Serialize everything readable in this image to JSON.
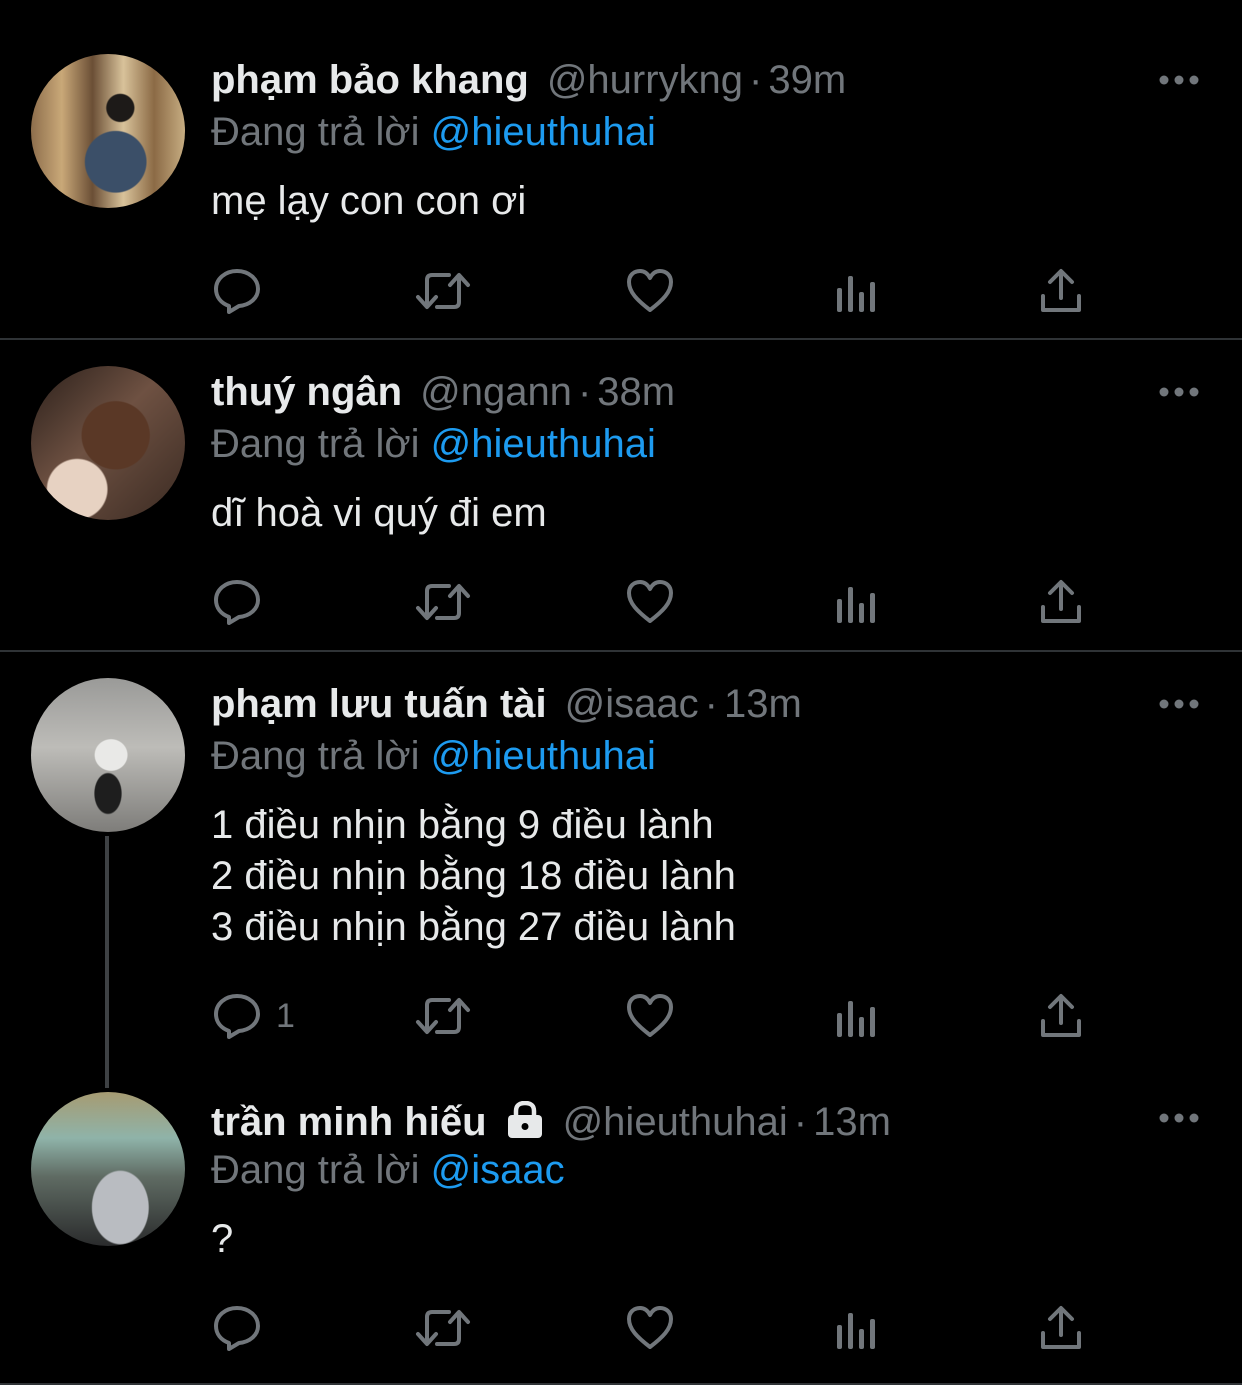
{
  "reply_prefix": "Đang trả lời",
  "colors": {
    "background": "#000000",
    "text": "#e7e9ea",
    "muted": "#71767b",
    "mention": "#1d9bf0",
    "divider": "#2f3336"
  },
  "tweets": [
    {
      "name": "phạm bảo khang",
      "handle": "@hurrykng",
      "separator": "·",
      "time": "39m",
      "reply_to": "@hieuthuhai",
      "text": "mẹ lạy con con ơi",
      "reply_count": "",
      "locked": false
    },
    {
      "name": "thuý ngân",
      "handle": "@ngann",
      "separator": "·",
      "time": "38m",
      "reply_to": "@hieuthuhai",
      "text": "dĩ hoà vi quý đi em",
      "reply_count": "",
      "locked": false
    },
    {
      "name": "phạm lưu tuấn tài",
      "handle": "@isaac",
      "separator": "·",
      "time": "13m",
      "reply_to": "@hieuthuhai",
      "text": "1 điều nhịn bằng 9 điều lành\n2 điều nhịn bằng 18 điều lành\n3 điều nhịn bằng 27 điều lành",
      "reply_count": "1",
      "locked": false
    },
    {
      "name": "trần minh hiếu",
      "handle": "@hieuthuhai",
      "separator": "·",
      "time": "13m",
      "reply_to": "@isaac",
      "text": "?",
      "reply_count": "",
      "locked": true
    }
  ],
  "icons": [
    "reply-icon",
    "retweet-icon",
    "like-icon",
    "analytics-icon",
    "share-icon",
    "more-icon",
    "lock-icon"
  ]
}
